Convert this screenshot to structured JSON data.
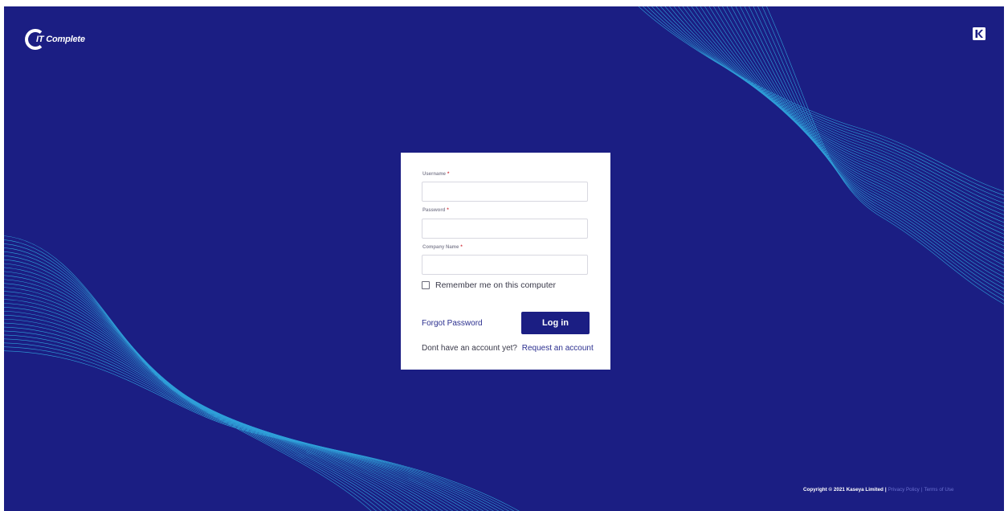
{
  "app": {
    "logo_text": "IT Complete",
    "logo_icon": "it-complete-logo",
    "brand_icon": "kaseya-k-logo"
  },
  "colors": {
    "background": "#1b1e83",
    "wave_lines": "#33b7e8",
    "button": "#1b1e83",
    "required": "#d2323c",
    "link": "#2b2f8f"
  },
  "form": {
    "username_label": "Username",
    "password_label": "Password",
    "company_label": "Company Name",
    "required_marker": "*",
    "username_value": "",
    "password_value": "",
    "company_value": "",
    "remember_label": "Remember me on this computer",
    "remember_checked": false,
    "forgot_label": "Forgot Password",
    "login_label": "Log in",
    "no_account_text": "Dont have an account yet?",
    "request_account_label": "Request an account"
  },
  "footer": {
    "copyright": "Copyright © 2021 Kaseya Limited",
    "separator": "|",
    "privacy_label": "Privacy Policy",
    "terms_label": "Terms of Use"
  }
}
